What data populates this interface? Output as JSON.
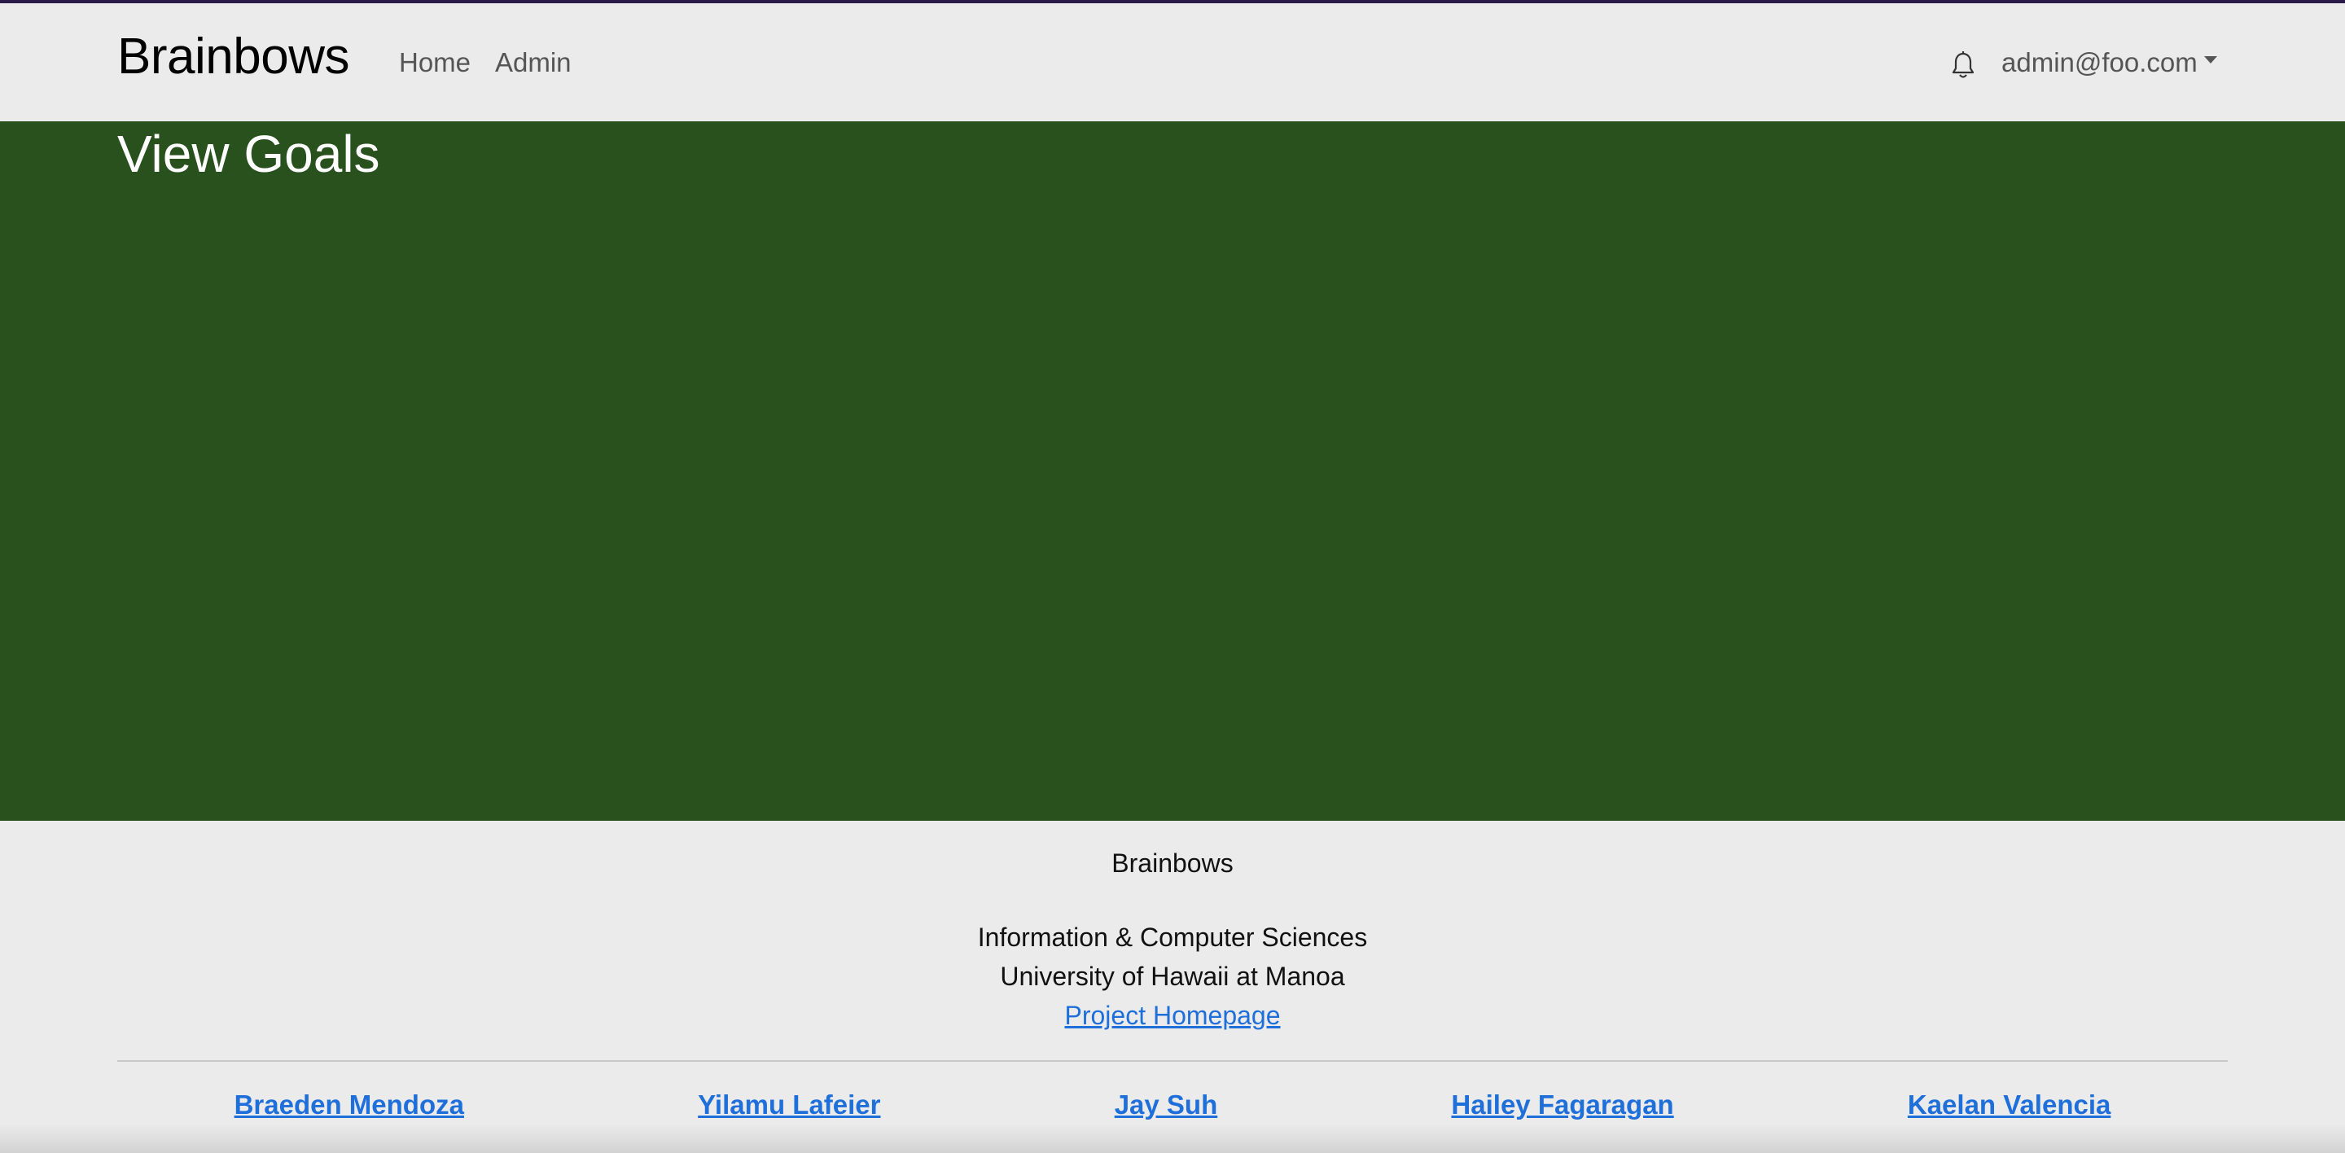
{
  "navbar": {
    "brand": "Brainbows",
    "links": [
      {
        "label": "Home"
      },
      {
        "label": "Admin"
      }
    ],
    "notification_icon": "bell-icon",
    "user_menu": "admin@foo.com"
  },
  "main": {
    "title": "View Goals",
    "background_color": "#29511e"
  },
  "footer": {
    "brand": "Brainbows",
    "department": "Information & Computer Sciences",
    "university": "University of Hawaii at Manoa",
    "homepage_link": "Project Homepage",
    "members": [
      "Braeden Mendoza",
      "Yilamu Lafeier",
      "Jay Suh",
      "Hailey Fagaragan",
      "Kaelan Valencia"
    ],
    "link_color": "#1f6fdb"
  }
}
